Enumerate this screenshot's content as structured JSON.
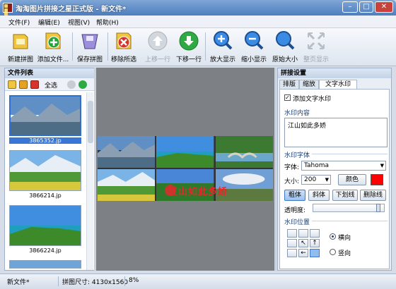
{
  "window": {
    "title": "淘淘图片拼接之星正式版 - 新文件*",
    "controls": {
      "minimize": "–",
      "maximize": "□",
      "close": "✕"
    }
  },
  "menubar": {
    "items": [
      "文件(F)",
      "编辑(E)",
      "视图(V)",
      "帮助(H)"
    ]
  },
  "toolbar": {
    "buttons": [
      {
        "label": "新建拼图",
        "icon": "new-puzzle-icon",
        "enabled": true
      },
      {
        "label": "添加文件...",
        "icon": "add-file-icon",
        "enabled": true
      },
      {
        "label": "保存拼图",
        "icon": "save-puzzle-icon",
        "enabled": true
      },
      {
        "label": "移除所选",
        "icon": "remove-selected-icon",
        "enabled": true
      },
      {
        "label": "上移一行",
        "icon": "move-up-icon",
        "enabled": false
      },
      {
        "label": "下移一行",
        "icon": "move-down-icon",
        "enabled": true
      },
      {
        "label": "放大显示",
        "icon": "zoom-in-icon",
        "enabled": true
      },
      {
        "label": "缩小显示",
        "icon": "zoom-out-icon",
        "enabled": true
      },
      {
        "label": "原始大小",
        "icon": "original-size-icon",
        "enabled": true
      },
      {
        "label": "整页显示",
        "icon": "fit-page-icon",
        "enabled": false
      }
    ]
  },
  "file_list": {
    "title": "文件列表",
    "select_all": "全选",
    "items": [
      {
        "name": "3865352.jp",
        "selected": true
      },
      {
        "name": "3866214.jp",
        "selected": false
      },
      {
        "name": "3866224.jp",
        "selected": false
      }
    ]
  },
  "canvas": {
    "watermark": "江山如此多娇"
  },
  "settings": {
    "title": "拼接设置",
    "tabs": [
      "排版",
      "缩放",
      "文字水印"
    ],
    "active_tab": "文字水印",
    "add_watermark_label": "添加文字水印",
    "add_watermark_checked": true,
    "content_label": "水印内容",
    "content_value": "江山如此多娇",
    "font_group_label": "水印字体",
    "font_label": "字体:",
    "font_value": "Tahoma",
    "size_label": "大小:",
    "size_value": "200",
    "color_button": "颜色",
    "color_value": "#ff0000",
    "style_buttons": [
      {
        "label": "粗体",
        "active": true
      },
      {
        "label": "斜体",
        "active": false
      },
      {
        "label": "下划线",
        "active": false
      },
      {
        "label": "删除线",
        "active": false
      }
    ],
    "opacity_label": "透明度:",
    "opacity_value": 0.97,
    "position_group_label": "水印位置",
    "orientation_horizontal": "横向",
    "orientation_vertical": "竖向",
    "orientation_selected": "横向",
    "position_arrows": [
      "↖",
      "↑",
      "←"
    ]
  },
  "statusbar": {
    "file": "新文件*",
    "size": "拼图尺寸: 4130x1560",
    "zoom": "8%"
  }
}
